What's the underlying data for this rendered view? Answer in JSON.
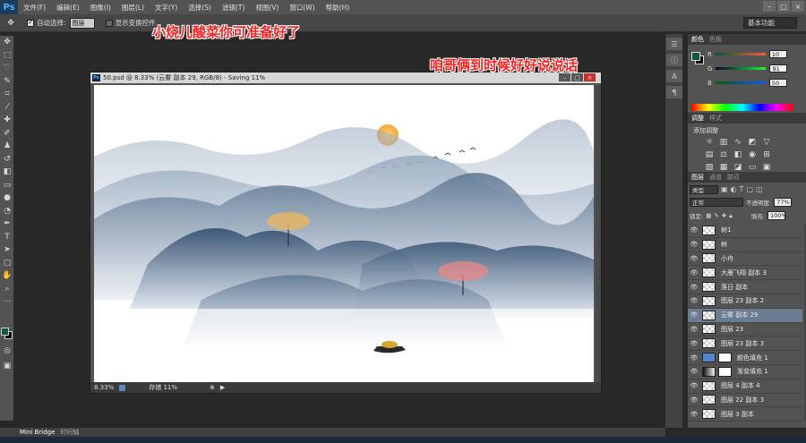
{
  "app": {
    "logo": "Ps"
  },
  "menu": [
    "文件(F)",
    "编辑(E)",
    "图像(I)",
    "图层(L)",
    "文字(Y)",
    "选择(S)",
    "滤镜(T)",
    "视图(V)",
    "窗口(W)",
    "帮助(H)"
  ],
  "options": {
    "auto_select_label": "自动选择:",
    "auto_select_value": "图层",
    "show_transform_label": "显示变换控件",
    "workspace": "基本功能"
  },
  "overlay": {
    "line1": "小烧儿酸菜你可准备好了",
    "line2": "咱哥俩到时候好好说说话"
  },
  "document": {
    "title": "50.psd @ 8.33% (云雾 副本 29, RGB/8) - Saving 11%",
    "zoom": "8.33%",
    "status": "存储 11%"
  },
  "color_panel": {
    "tabs": [
      "颜色",
      "色板"
    ],
    "r": "10",
    "g": "91",
    "b": "50",
    "fg_color": "#0f5a3a"
  },
  "adjust_panel": {
    "tabs": [
      "调整",
      "样式"
    ],
    "title": "添加调整"
  },
  "layers_panel": {
    "tabs": [
      "图层",
      "通道",
      "路径"
    ],
    "filter_label": "类型",
    "blend_mode": "正常",
    "opacity_label": "不透明度:",
    "opacity": "77%",
    "lock_label": "锁定:",
    "fill_label": "填充:",
    "fill": "100%",
    "layers": [
      {
        "name": "树1",
        "type": "normal"
      },
      {
        "name": "树",
        "type": "normal"
      },
      {
        "name": "小舟",
        "type": "normal"
      },
      {
        "name": "大雁飞翔 副本 3",
        "type": "normal"
      },
      {
        "name": "落日 副本",
        "type": "normal"
      },
      {
        "name": "图层 23 副本 2",
        "type": "normal"
      },
      {
        "name": "云雾 副本 29",
        "type": "normal",
        "selected": true
      },
      {
        "name": "图层 23",
        "type": "normal"
      },
      {
        "name": "图层 23 副本 3",
        "type": "normal"
      },
      {
        "name": "颜色填充 1",
        "type": "fill"
      },
      {
        "name": "渐变填充 1",
        "type": "gradient"
      },
      {
        "name": "图层 4 副本 4",
        "type": "normal"
      },
      {
        "name": "图层 22 副本 3",
        "type": "normal"
      },
      {
        "name": "图层 3 副本",
        "type": "normal"
      }
    ]
  },
  "bottom_tabs": [
    "Mini Bridge",
    "时间轴"
  ]
}
